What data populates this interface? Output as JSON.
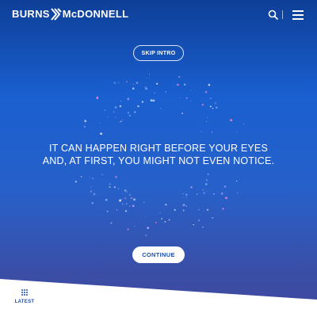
{
  "header": {
    "logo_left": "BURNS",
    "logo_right": "McDONNELL",
    "logo_icon": "burns-mcdonnell-mark",
    "search_icon": "search-icon",
    "menu_icon": "hamburger-menu-icon"
  },
  "intro": {
    "skip_label": "SKIP INTRO",
    "headline_line1": "IT CAN HAPPEN RIGHT BEFORE YOUR EYES",
    "headline_line2": "AND, AT FIRST, YOU MIGHT NOT EVEN NOTICE.",
    "continue_label": "CONTINUE"
  },
  "bottom_nav": {
    "latest_label": "LATEST",
    "latest_icon": "grid-dots-icon"
  },
  "colors": {
    "accent": "#1a4fb4",
    "background_top": "#0e3f97",
    "background_bottom": "#41479c"
  }
}
